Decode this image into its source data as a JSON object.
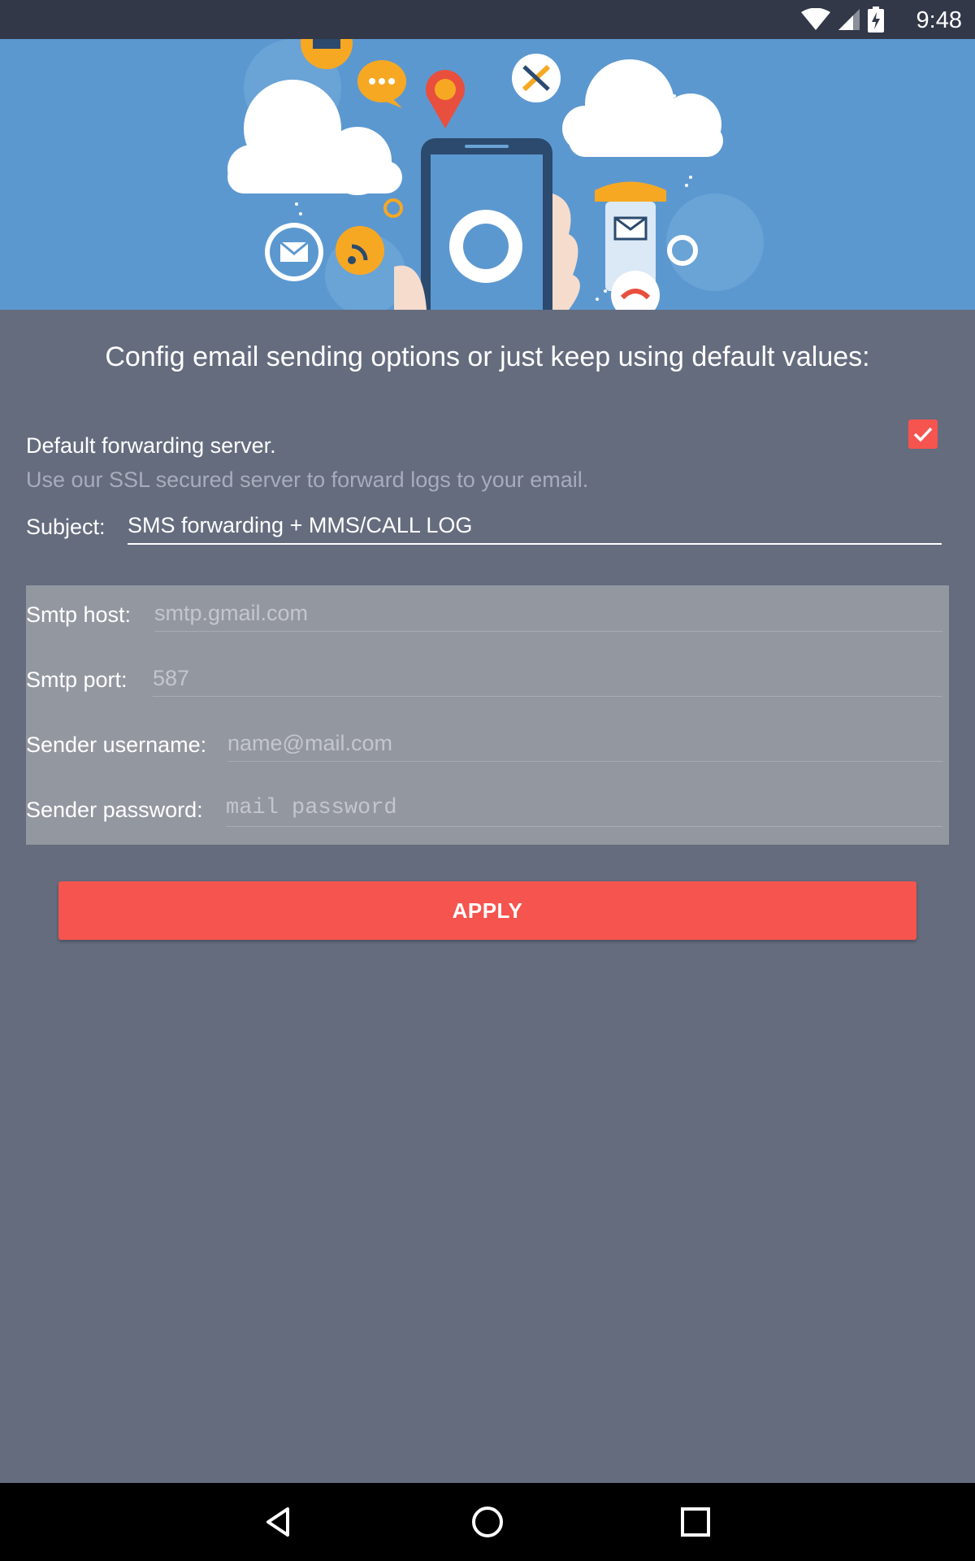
{
  "status_bar": {
    "time": "9:48",
    "icons": [
      "wifi-icon",
      "signal-icon",
      "battery-charging-icon"
    ]
  },
  "hero": {
    "image": "mobile-communication-illustration"
  },
  "headline": "Config email sending options or just keep using default values:",
  "default_server": {
    "label": "Default forwarding server.",
    "description": "Use our SSL secured server to forward logs to your email.",
    "checked": true
  },
  "subject": {
    "label": "Subject:",
    "value": "SMS forwarding + MMS/CALL LOG"
  },
  "smtp": {
    "host_label": "Smtp host:",
    "host_placeholder": "smtp.gmail.com",
    "port_label": "Smtp port:",
    "port_placeholder": "587",
    "username_label": "Sender username:",
    "username_placeholder": "name@mail.com",
    "password_label": "Sender password:",
    "password_placeholder": "mail password"
  },
  "apply_label": "APPLY",
  "nav_bar": {
    "icons": [
      "back-icon",
      "home-icon",
      "recents-icon"
    ]
  },
  "colors": {
    "background": "#656c7e",
    "accent": "#f6544e",
    "hero": "#5c98d0",
    "status_bar": "#323847"
  }
}
